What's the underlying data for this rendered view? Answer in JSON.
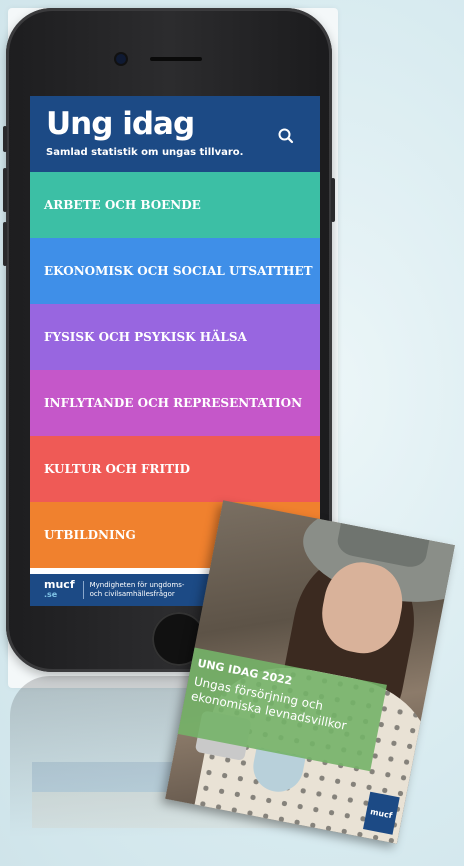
{
  "header": {
    "brand": "Ung idag",
    "tagline": "Samlad statistik om ungas tillvaro.",
    "search_icon": "search-icon"
  },
  "menu": [
    {
      "label": "ARBETE OCH BOENDE",
      "color": "#3cbfa5"
    },
    {
      "label": "EKONOMISK OCH SOCIAL UTSATTHET",
      "color": "#3f8fe8"
    },
    {
      "label": "FYSISK OCH PSYKISK HÄLSA",
      "color": "#9866e0"
    },
    {
      "label": "INFLYTANDE OCH REPRESENTATION",
      "color": "#c557c9"
    },
    {
      "label": "KULTUR OCH FRITID",
      "color": "#ef5a56"
    },
    {
      "label": "UTBILDNING",
      "color": "#f0812e"
    }
  ],
  "footer": {
    "logo": "mucf",
    "logo_sub": ".se",
    "line1": "Myndigheten för ungdoms-",
    "line2": "och civilsamhällesfrågor"
  },
  "booklet": {
    "title": "UNG IDAG 2022",
    "subtitle": "Ungas försörjning och ekonomiska levnadsvillkor",
    "logo": "mucf"
  },
  "colors": {
    "header_blue": "#1c4a85",
    "background": "#ddeef3"
  }
}
